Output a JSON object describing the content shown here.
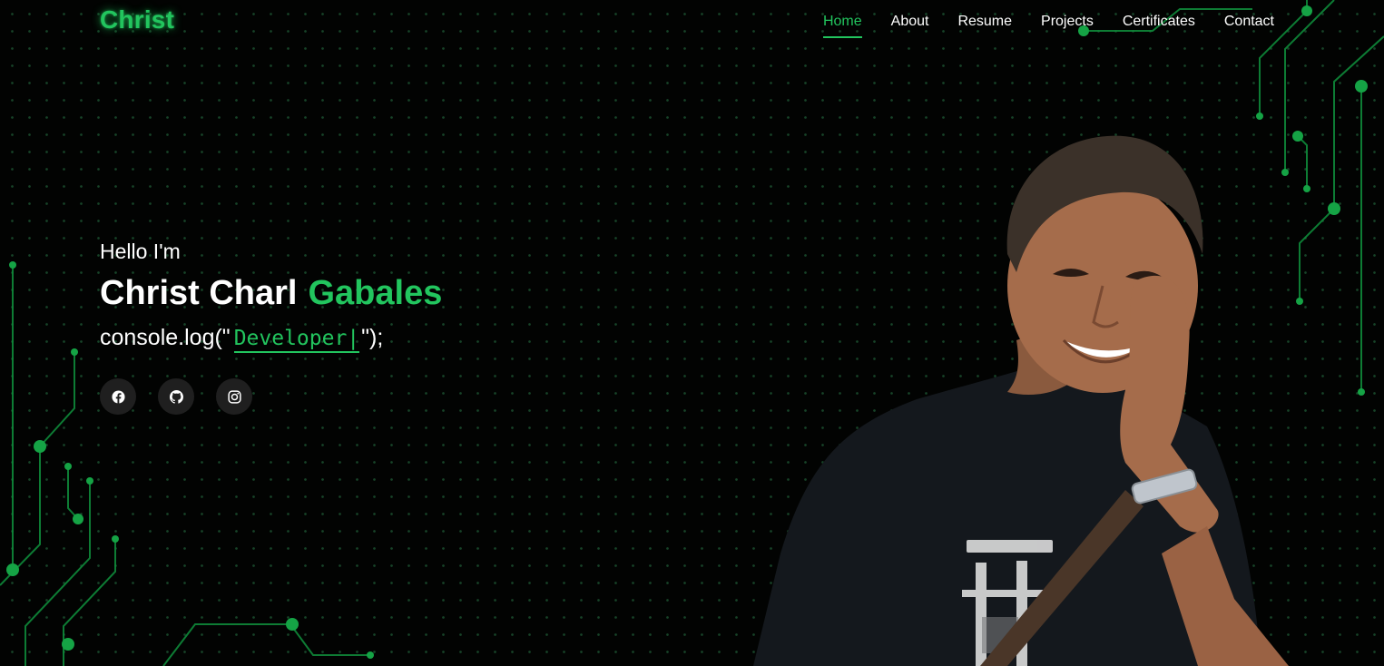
{
  "brand": {
    "logo": "Christ"
  },
  "nav": {
    "items": [
      {
        "label": "Home",
        "active": true
      },
      {
        "label": "About",
        "active": false
      },
      {
        "label": "Resume",
        "active": false
      },
      {
        "label": "Projects",
        "active": false
      },
      {
        "label": "Certificates",
        "active": false
      },
      {
        "label": "Contact",
        "active": false
      }
    ]
  },
  "hero": {
    "greeting": "Hello I'm",
    "first_name": "Christ Charl",
    "last_name": "Gabales",
    "console_prefix": "console.log(\"",
    "role": "Developer|",
    "console_suffix": "\");"
  },
  "socials": [
    {
      "icon": "facebook-icon"
    },
    {
      "icon": "github-icon"
    },
    {
      "icon": "instagram-icon"
    }
  ],
  "colors": {
    "accent": "#22c55e",
    "background": "#020302",
    "social_bg": "#1f1f1f"
  }
}
